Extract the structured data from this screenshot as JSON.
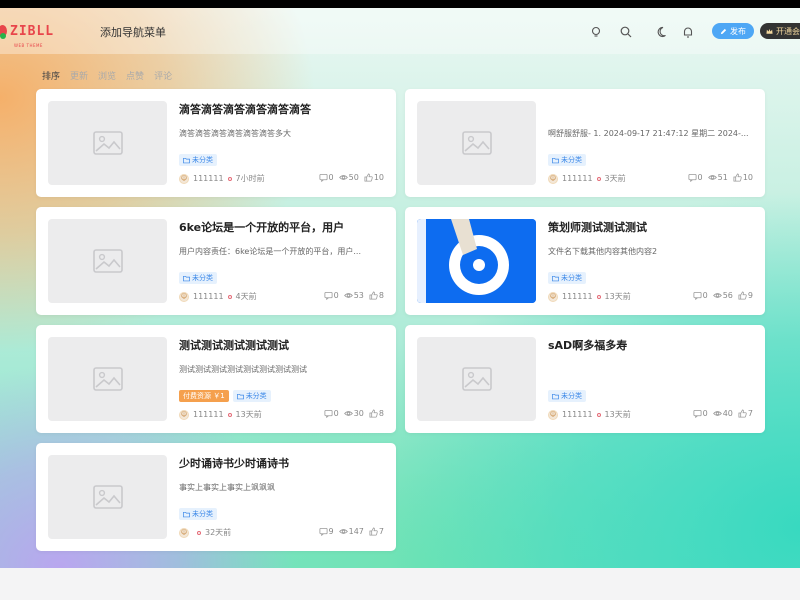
{
  "header": {
    "logo_text": "ZIBLL",
    "logo_tagline": "WEB THEME",
    "nav_menu_label": "添加导航菜单",
    "icons": [
      "bulb-icon",
      "search-icon",
      "moon-icon",
      "bell-icon"
    ],
    "publish_label": "发布",
    "vip_label": "开通会"
  },
  "sort_bar": {
    "items": [
      "排序",
      "更新",
      "浏览",
      "点赞",
      "评论"
    ]
  },
  "colors": {
    "accent_blue": "#4ea7f5",
    "paid_tag": "#f5a04d",
    "category_tag_text": "#3a87e8"
  },
  "posts": [
    {
      "title": "滴答滴答滴答滴答滴答滴答",
      "excerpt": "滴答滴答滴答滴答滴答滴答多大",
      "tags": [
        "未分类"
      ],
      "author": "111111",
      "time": "7小时前",
      "comments": "0",
      "views": "50",
      "likes": "10"
    },
    {
      "title": "",
      "excerpt": "啊舒服舒服- 1. 2024-09-17 21:47:12 星期二 2024-...",
      "tags": [
        "未分类"
      ],
      "author": "111111",
      "time": "3天前",
      "comments": "0",
      "views": "51",
      "likes": "10"
    },
    {
      "title": "6ke论坛是一个开放的平台，用户",
      "excerpt": "用户内容责任：6ke论坛是一个开放的平台，用户...",
      "tags": [
        "未分类"
      ],
      "author": "111111",
      "time": "4天前",
      "comments": "0",
      "views": "53",
      "likes": "8"
    },
    {
      "title": "策划师测试测试测试",
      "excerpt": "文件名下载其他内容其他内容2",
      "tags": [
        "未分类"
      ],
      "author": "111111",
      "time": "13天前",
      "comments": "0",
      "views": "56",
      "likes": "9",
      "thumbnail": "6ke-logo"
    },
    {
      "title": "测试测试测试测试测试",
      "excerpt": "测试测试测试测试测试测试测试测试",
      "paid_tag": "付费资源 ￥1",
      "tags": [
        "未分类"
      ],
      "author": "111111",
      "time": "13天前",
      "comments": "0",
      "views": "30",
      "likes": "8"
    },
    {
      "title": "sAD啊多福多寿",
      "excerpt": "",
      "tags": [
        "未分类"
      ],
      "author": "111111",
      "time": "13天前",
      "comments": "0",
      "views": "40",
      "likes": "7"
    },
    {
      "title": "少时诵诗书少时诵诗书",
      "excerpt": "事实上事实上事实上飒飒飒",
      "tags": [
        "未分类"
      ],
      "author": "",
      "time": "32天前",
      "comments": "9",
      "views": "147",
      "likes": "7"
    }
  ]
}
